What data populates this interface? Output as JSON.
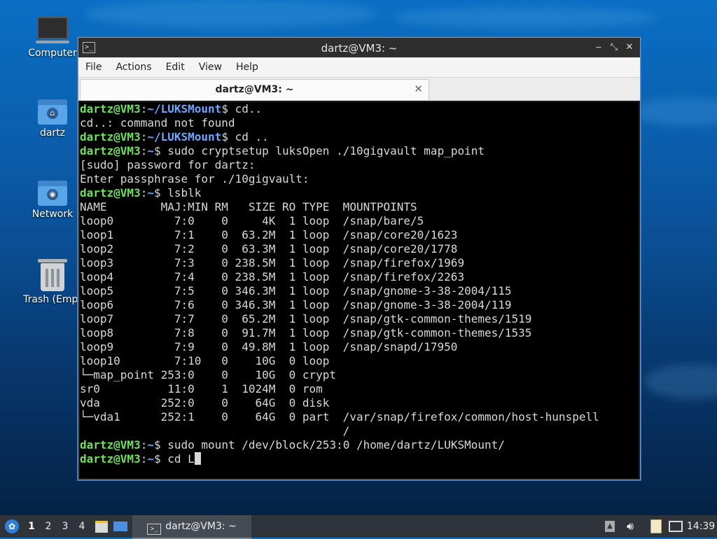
{
  "desktop": {
    "icons": [
      {
        "label": "Computer"
      },
      {
        "label": "dartz"
      },
      {
        "label": "Network"
      },
      {
        "label": "Trash (Empt"
      }
    ]
  },
  "window": {
    "title": "dartz@VM3: ~",
    "menu": [
      "File",
      "Actions",
      "Edit",
      "View",
      "Help"
    ],
    "tab_title": "dartz@VM3: ~",
    "icons": {
      "app": "terminal-icon",
      "minimize": "minimize-icon",
      "maximize": "maximize-icon",
      "close": "close-icon",
      "tab_close": "close-icon"
    }
  },
  "terminal": {
    "lines": [
      {
        "type": "prompt",
        "user": "dartz@VM3",
        "path": "~/LUKSMount",
        "cmd": "cd.."
      },
      {
        "type": "out",
        "text": "cd..: command not found"
      },
      {
        "type": "prompt",
        "user": "dartz@VM3",
        "path": "~/LUKSMount",
        "cmd": "cd .."
      },
      {
        "type": "prompt",
        "user": "dartz@VM3",
        "path": "~",
        "cmd": "sudo cryptsetup luksOpen ./10gigvault map_point"
      },
      {
        "type": "out",
        "text": "[sudo] password for dartz:"
      },
      {
        "type": "out",
        "text": "Enter passphrase for ./10gigvault:"
      },
      {
        "type": "prompt",
        "user": "dartz@VM3",
        "path": "~",
        "cmd": "lsblk"
      },
      {
        "type": "out",
        "text": "NAME        MAJ:MIN RM   SIZE RO TYPE  MOUNTPOINTS"
      },
      {
        "type": "out",
        "text": "loop0         7:0    0     4K  1 loop  /snap/bare/5"
      },
      {
        "type": "out",
        "text": "loop1         7:1    0  63.2M  1 loop  /snap/core20/1623"
      },
      {
        "type": "out",
        "text": "loop2         7:2    0  63.3M  1 loop  /snap/core20/1778"
      },
      {
        "type": "out",
        "text": "loop3         7:3    0 238.5M  1 loop  /snap/firefox/1969"
      },
      {
        "type": "out",
        "text": "loop4         7:4    0 238.5M  1 loop  /snap/firefox/2263"
      },
      {
        "type": "out",
        "text": "loop5         7:5    0 346.3M  1 loop  /snap/gnome-3-38-2004/115"
      },
      {
        "type": "out",
        "text": "loop6         7:6    0 346.3M  1 loop  /snap/gnome-3-38-2004/119"
      },
      {
        "type": "out",
        "text": "loop7         7:7    0  65.2M  1 loop  /snap/gtk-common-themes/1519"
      },
      {
        "type": "out",
        "text": "loop8         7:8    0  91.7M  1 loop  /snap/gtk-common-themes/1535"
      },
      {
        "type": "out",
        "text": "loop9         7:9    0  49.8M  1 loop  /snap/snapd/17950"
      },
      {
        "type": "out",
        "text": "loop10        7:10   0    10G  0 loop"
      },
      {
        "type": "out",
        "text": "└─map_point 253:0    0    10G  0 crypt"
      },
      {
        "type": "out",
        "text": "sr0          11:0    1  1024M  0 rom"
      },
      {
        "type": "out",
        "text": "vda         252:0    0    64G  0 disk"
      },
      {
        "type": "out",
        "text": "└─vda1      252:1    0    64G  0 part  /var/snap/firefox/common/host-hunspell"
      },
      {
        "type": "out",
        "text": "                                       /"
      },
      {
        "type": "prompt",
        "user": "dartz@VM3",
        "path": "~",
        "cmd": "sudo mount /dev/block/253:0 /home/dartz/LUKSMount/"
      },
      {
        "type": "prompt",
        "user": "dartz@VM3",
        "path": "~",
        "cmd": "cd L",
        "cursor": true
      }
    ]
  },
  "taskbar": {
    "workspaces": [
      "1",
      "2",
      "3",
      "4"
    ],
    "active_workspace": "1",
    "task_label": "dartz@VM3: ~",
    "clock": "14:39",
    "icons": {
      "start": "start-menu-icon",
      "files": "file-manager-icon",
      "desktop": "show-desktop-icon",
      "updates": "update-icon",
      "volume": "volume-icon",
      "clipboard": "clipboard-icon",
      "network": "network-icon"
    }
  }
}
